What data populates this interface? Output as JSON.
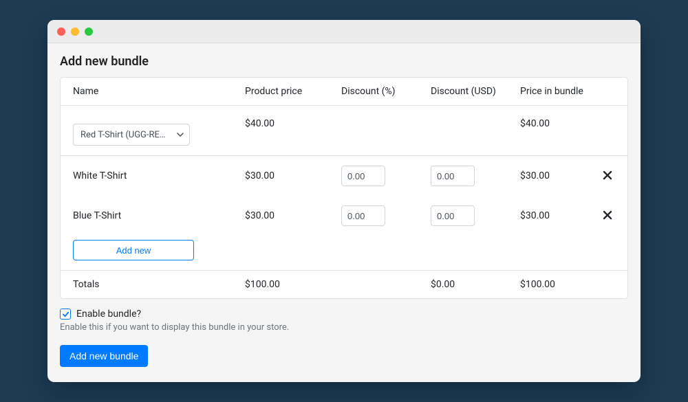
{
  "page_title": "Add new bundle",
  "columns": {
    "name": "Name",
    "product_price": "Product price",
    "discount_pct": "Discount (%)",
    "discount_usd": "Discount (USD)",
    "price_in_bundle": "Price in bundle"
  },
  "main_product": {
    "selected_label": "Red T-Shirt (UGG-RED-…",
    "price": "$40.00",
    "bundle_price": "$40.00"
  },
  "items": [
    {
      "name": "White T-Shirt",
      "price": "$30.00",
      "discount_pct": "0.00",
      "discount_usd": "0.00",
      "bundle_price": "$30.00"
    },
    {
      "name": "Blue T-Shirt",
      "price": "$30.00",
      "discount_pct": "0.00",
      "discount_usd": "0.00",
      "bundle_price": "$30.00"
    }
  ],
  "buttons": {
    "add_new": "Add new",
    "submit": "Add new bundle"
  },
  "totals": {
    "label": "Totals",
    "product_price": "$100.00",
    "discount_usd": "$0.00",
    "bundle_price": "$100.00"
  },
  "enable": {
    "checked": true,
    "label": "Enable bundle?",
    "help": "Enable this if you want to display this bundle in your store."
  }
}
